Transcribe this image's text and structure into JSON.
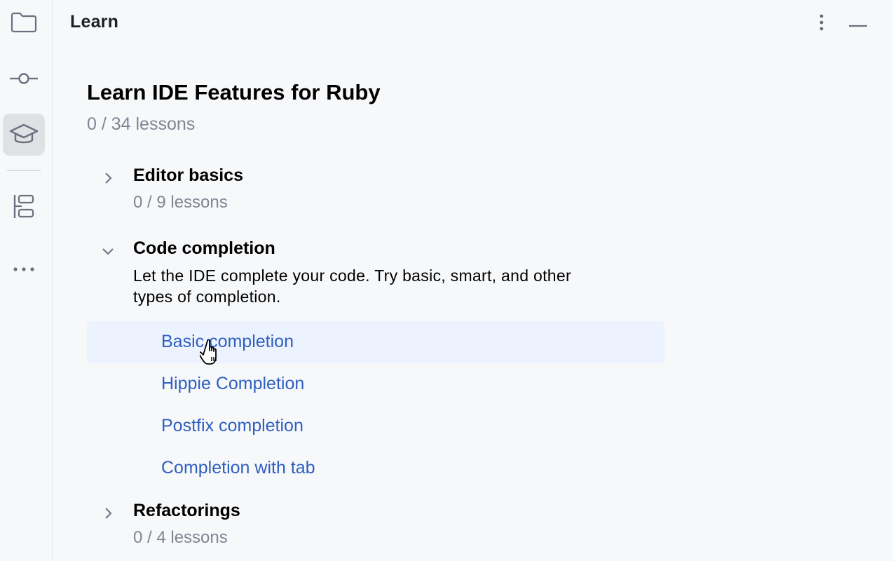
{
  "panel": {
    "title": "Learn",
    "more_icon": "vertical-ellipsis-icon",
    "minimize_icon": "minimize-icon"
  },
  "toolstrip": {
    "items": [
      {
        "name": "project",
        "icon": "folder-icon",
        "active": false
      },
      {
        "name": "commit",
        "icon": "commit-icon",
        "active": false
      },
      {
        "name": "learn",
        "icon": "graduation-cap-icon",
        "active": true
      },
      {
        "name": "structure",
        "icon": "structure-icon",
        "active": false
      },
      {
        "name": "more",
        "icon": "more-horizontal-icon",
        "active": false
      }
    ]
  },
  "course": {
    "title": "Learn IDE Features for Ruby",
    "progress": "0 / 34 lessons"
  },
  "modules": [
    {
      "title": "Editor basics",
      "progress": "0 / 9 lessons",
      "expanded": false
    },
    {
      "title": "Code completion",
      "description_line1": "Let the IDE complete your code. Try basic, smart, and other",
      "description_line2": "types of completion.",
      "expanded": true,
      "lessons": [
        {
          "label": "Basic completion",
          "hovered": true
        },
        {
          "label": "Hippie Completion",
          "hovered": false
        },
        {
          "label": "Postfix completion",
          "hovered": false
        },
        {
          "label": "Completion with tab",
          "hovered": false
        }
      ]
    },
    {
      "title": "Refactorings",
      "progress": "0 / 4 lessons",
      "expanded": false
    }
  ],
  "colors": {
    "background": "#f7f8fa",
    "link": "#2f5fbf",
    "muted_text": "#818594",
    "hover_highlight": "#edf3fe",
    "active_tool_bg": "#dfe1e5"
  }
}
